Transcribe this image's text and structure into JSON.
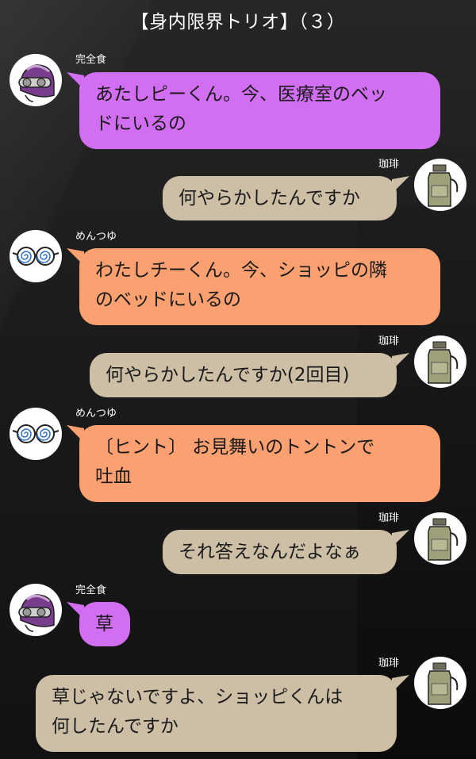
{
  "chat_title": "【身内限界トリオ】（３）",
  "colors": {
    "purple_bubble": "#d26ef2",
    "orange_bubble": "#fba070",
    "tan_bubble": "#cdbfa6",
    "background": "#161616"
  },
  "participants": {
    "kanzenshoku": {
      "name": "完全食",
      "avatar_icon": "helmet-goggles-icon"
    },
    "mentsuyu": {
      "name": "めんつゆ",
      "avatar_icon": "swirl-glasses-icon"
    },
    "coffee": {
      "name": "珈琲",
      "avatar_icon": "coffee-bottle-icon"
    }
  },
  "messages": [
    {
      "sender": "完全食",
      "line1": "あたしピーくん。今、医療室のベッ",
      "line2": "ドにいるの"
    },
    {
      "sender": "珈琲",
      "line1": "何やらかしたんですか"
    },
    {
      "sender": "めんつゆ",
      "line1": "わたしチーくん。今、ショッピの隣",
      "line2": "のベッドにいるの"
    },
    {
      "sender": "珈琲",
      "line1": "何やらかしたんですか(2回目)"
    },
    {
      "sender": "めんつゆ",
      "line1": "〔ヒント〕 お見舞いのトントンで",
      "line2": "吐血"
    },
    {
      "sender": "珈琲",
      "line1": "それ答えなんだよなぁ"
    },
    {
      "sender": "完全食",
      "line1": "草"
    },
    {
      "sender": "珈琲",
      "line1": "草じゃないですよ、ショッピくんは",
      "line2": "何したんですか"
    }
  ]
}
